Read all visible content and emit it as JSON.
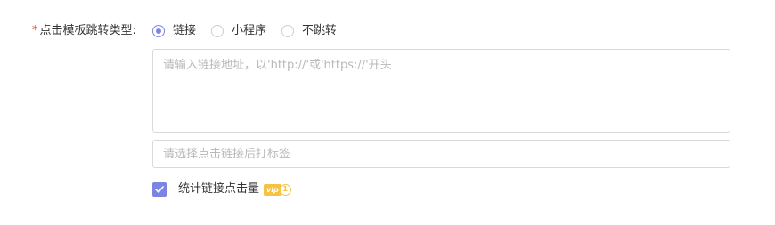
{
  "form": {
    "required_mark": "*",
    "label": "点击模板跳转类型:",
    "jump_type": {
      "selected": "链接",
      "options": [
        {
          "label": "链接",
          "checked": true
        },
        {
          "label": "小程序",
          "checked": false
        },
        {
          "label": "不跳转",
          "checked": false
        }
      ]
    },
    "url_field": {
      "placeholder": "请输入链接地址，以'http://'或'https://'开头",
      "value": ""
    },
    "tag_field": {
      "placeholder": "请选择点击链接后打标签",
      "value": ""
    },
    "stats_checkbox": {
      "label": "统计链接点击量",
      "checked": true,
      "badge_text": "vip",
      "badge_level": "1"
    }
  },
  "colors": {
    "accent": "#7b84e3",
    "required": "#ed4014",
    "vip": "#f5c242",
    "border": "#d9d9d9",
    "placeholder": "#b9b9b9"
  }
}
